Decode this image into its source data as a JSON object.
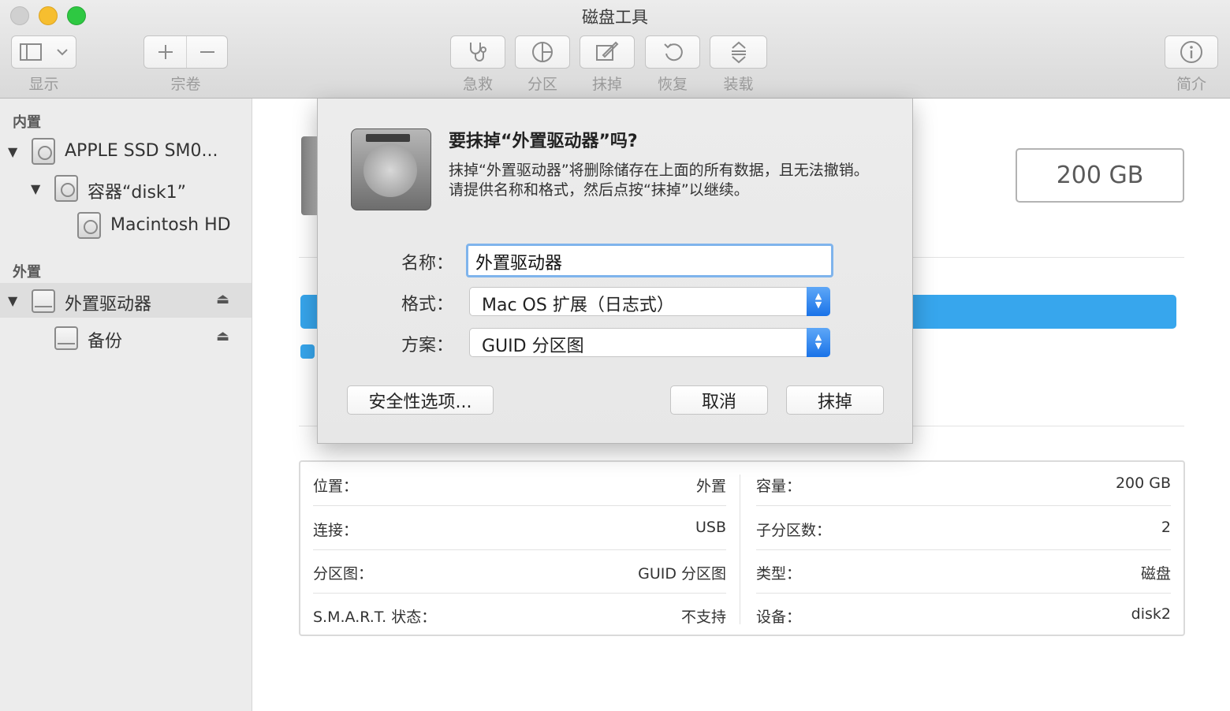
{
  "window": {
    "title": "磁盘工具"
  },
  "toolbar": {
    "view_label": "显示",
    "volume_label": "宗卷",
    "first_aid_label": "急救",
    "partition_label": "分区",
    "erase_label": "抹掉",
    "restore_label": "恢复",
    "mount_label": "装载",
    "info_label": "简介"
  },
  "sidebar": {
    "internal_header": "内置",
    "external_header": "外置",
    "items": [
      {
        "label": "APPLE SSD SM0..."
      },
      {
        "label": "容器“disk1”"
      },
      {
        "label": "Macintosh HD"
      },
      {
        "label": "外置驱动器"
      },
      {
        "label": "备份"
      }
    ]
  },
  "main": {
    "capacity_display": "200 GB",
    "usage_percent": 100,
    "info": [
      {
        "key": "位置：",
        "value": "外置"
      },
      {
        "key": "容量：",
        "value": "200 GB"
      },
      {
        "key": "连接：",
        "value": "USB"
      },
      {
        "key": "子分区数：",
        "value": "2"
      },
      {
        "key": "分区图：",
        "value": "GUID 分区图"
      },
      {
        "key": "类型：",
        "value": "磁盘"
      },
      {
        "key": "S.M.A.R.T. 状态：",
        "value": "不支持"
      },
      {
        "key": "设备：",
        "value": "disk2"
      }
    ]
  },
  "sheet": {
    "title": "要抹掉“外置驱动器”吗?",
    "message": "抹掉“外置驱动器”将删除储存在上面的所有数据，且无法撤销。请提供名称和格式，然后点按“抹掉”以继续。",
    "name_label": "名称：",
    "name_value": "外置驱动器",
    "format_label": "格式：",
    "format_value": "Mac OS 扩展（日志式）",
    "scheme_label": "方案：",
    "scheme_value": "GUID 分区图",
    "security_button": "安全性选项...",
    "cancel_button": "取消",
    "erase_button": "抹掉"
  },
  "colors": {
    "accent": "#37a6ed",
    "popup_accent": "#1a73e8",
    "focus_ring": "#7fb4ec"
  },
  "icons": [
    "sidebar-icon",
    "chevron-down-icon",
    "plus-icon",
    "minus-icon",
    "stethoscope-icon",
    "pie-chart-icon",
    "eraser-icon",
    "restore-icon",
    "mount-icon",
    "info-icon",
    "disclosure-triangle-icon",
    "hard-drive-icon",
    "external-drive-icon",
    "eject-icon",
    "popup-arrows-icon"
  ]
}
